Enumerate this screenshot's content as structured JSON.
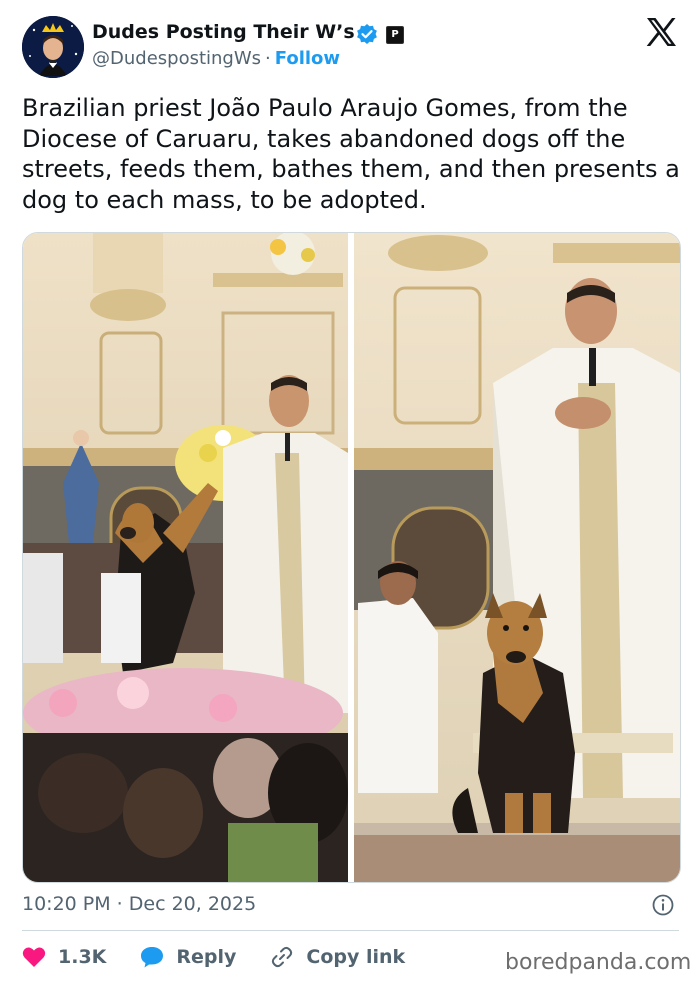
{
  "author": {
    "name": "Dudes Posting Their W’s",
    "handle": "@DudespostingWs",
    "separator": "·",
    "follow_label": "Follow",
    "verified_icon": "verified-badge-icon",
    "affiliate_badge": "P"
  },
  "post": {
    "text": "Brazilian priest João Paulo Araujo Gomes, from the Diocese of Caruaru, takes abandoned dogs off the streets, feeds them, bathes them, and then presents a dog to each mass, to be adopted."
  },
  "meta": {
    "timestamp": "10:20 PM · Dec 20, 2025"
  },
  "actions": {
    "likes": "1.3K",
    "reply_label": "Reply",
    "copy_label": "Copy link"
  },
  "watermark": "boredpanda.com",
  "colors": {
    "accent": "#1d9bf0",
    "like": "#f91880",
    "text": "#0f1419",
    "muted": "#536471"
  }
}
